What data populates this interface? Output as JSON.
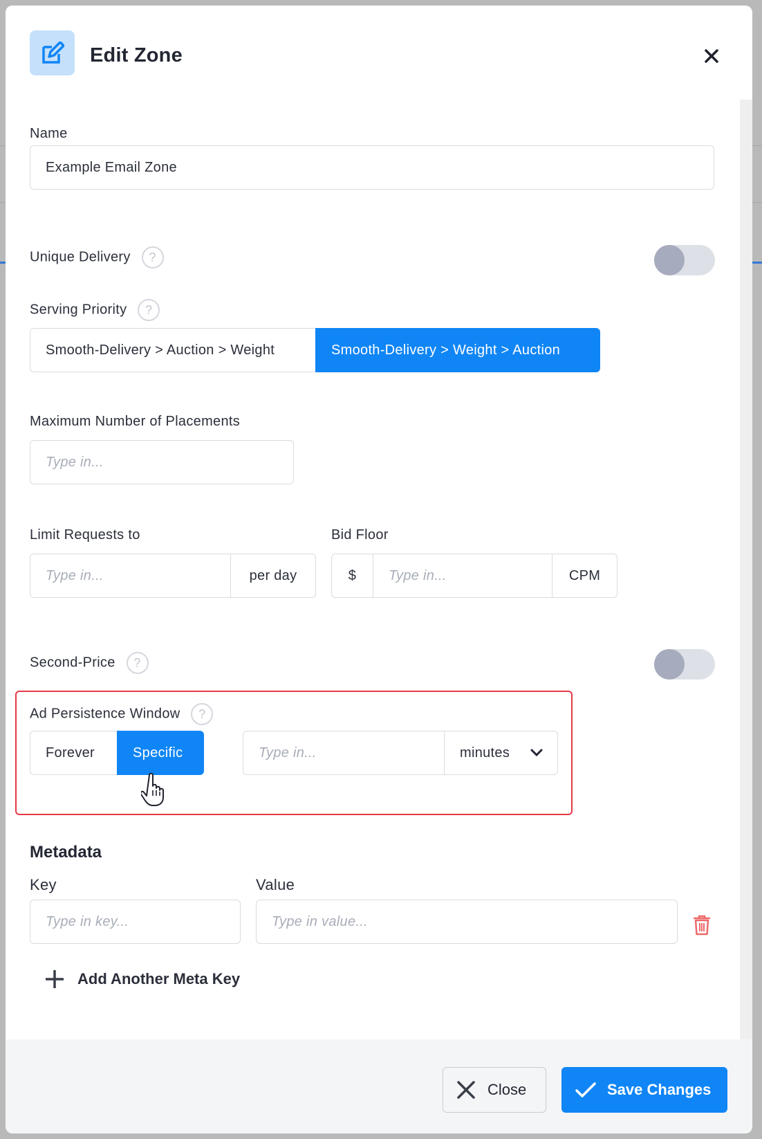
{
  "dialog": {
    "title": "Edit Zone",
    "icon": "edit-icon",
    "accent_color": "#1085f5"
  },
  "name": {
    "label": "Name",
    "value": "Example Email Zone"
  },
  "unique_delivery": {
    "label": "Unique Delivery",
    "help": "?",
    "enabled": false
  },
  "serving_priority": {
    "label": "Serving Priority",
    "help": "?",
    "options": [
      "Smooth-Delivery > Auction > Weight",
      "Smooth-Delivery > Weight > Auction"
    ],
    "selected": "Smooth-Delivery > Weight > Auction"
  },
  "max_placements": {
    "label": "Maximum Number of Placements",
    "placeholder": "Type in..."
  },
  "limit_requests": {
    "label": "Limit Requests to",
    "placeholder": "Type in...",
    "suffix": "per day"
  },
  "bid_floor": {
    "label": "Bid Floor",
    "prefix": "$",
    "placeholder": "Type in...",
    "suffix": "CPM"
  },
  "second_price": {
    "label": "Second-Price",
    "help": "?",
    "enabled": false
  },
  "ad_persistence": {
    "label": "Ad Persistence Window",
    "help": "?",
    "options": [
      "Forever",
      "Specific"
    ],
    "selected": "Specific",
    "placeholder": "Type in...",
    "unit": "minutes"
  },
  "metadata": {
    "title": "Metadata",
    "key_label": "Key",
    "value_label": "Value",
    "key_placeholder": "Type in key...",
    "value_placeholder": "Type in value...",
    "add_label": "Add Another Meta Key"
  },
  "footer": {
    "close_label": "Close",
    "save_label": "Save Changes"
  }
}
